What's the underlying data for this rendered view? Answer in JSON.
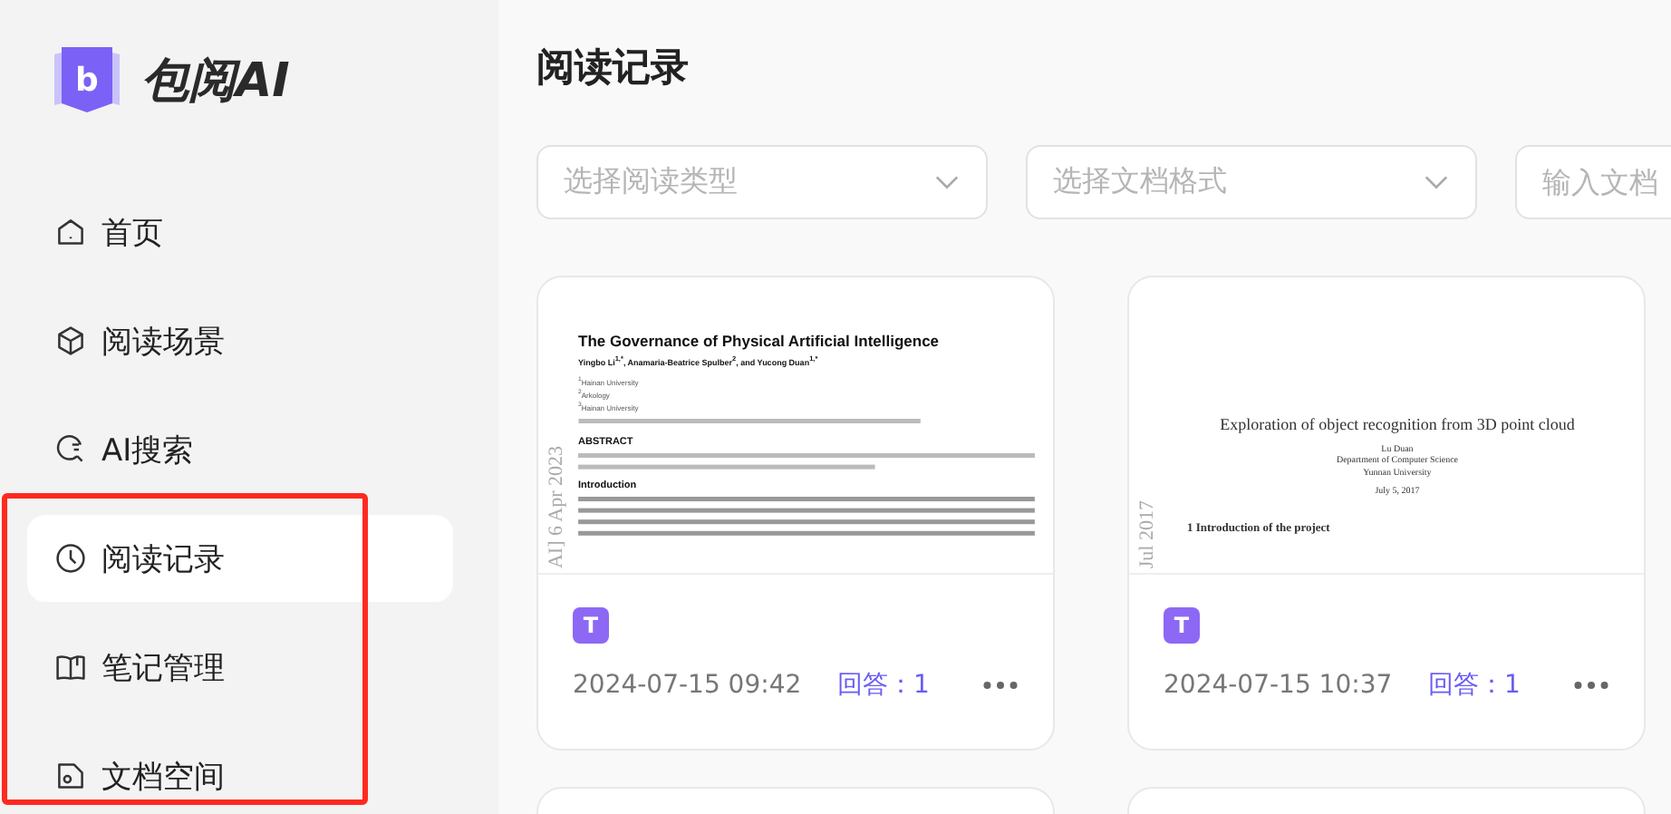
{
  "app": {
    "name": "包阅AI",
    "logo_letter": "b"
  },
  "nav": [
    {
      "label": "首页",
      "selected": false
    },
    {
      "label": "阅读场景",
      "selected": false
    },
    {
      "label": "AI搜索",
      "selected": false
    },
    {
      "label": "阅读记录",
      "selected": true
    },
    {
      "label": "笔记管理",
      "selected": false
    },
    {
      "label": "文档空间",
      "selected": false
    }
  ],
  "page_title": "阅读记录",
  "filters": [
    {
      "kind": "select",
      "placeholder": "选择阅读类型"
    },
    {
      "kind": "select",
      "placeholder": "选择文档格式"
    },
    {
      "kind": "input",
      "placeholder": "输入文档"
    }
  ],
  "cards": [
    {
      "kind": "full",
      "preview": {
        "kind": "sans",
        "side_stamp": "AI] 6 Apr 2023",
        "title": "The Governance of Physical Artificial Intelligence",
        "authors": "Yingbo Li$^{1,*}$, Anamaria-Beatrice Spulber$^{2}$, and Yucong Duan$^{1,*}$",
        "lines": [
          "$^{1}$Hainan University",
          "$^{2}$Arkology",
          "$^{3}$Hainan University"
        ],
        "headings": [
          "ABSTRACT",
          "Introduction"
        ]
      },
      "badge": "T",
      "time": "2024-07-15 09:42",
      "answers": "回答：1"
    },
    {
      "kind": "full",
      "preview": {
        "kind": "serif",
        "side_stamp": "Jul 2017",
        "title": "Exploration of object recognition from 3D point cloud",
        "authors": "Lu Duan",
        "lines": [
          "Department of Computer Science",
          "Yunnan University",
          "July 5, 2017"
        ],
        "headings": [
          "1   Introduction of the project"
        ]
      },
      "badge": "T",
      "time": "2024-07-15 10:37",
      "answers": "回答：1"
    },
    {
      "kind": "cut"
    },
    {
      "kind": "cut"
    }
  ]
}
